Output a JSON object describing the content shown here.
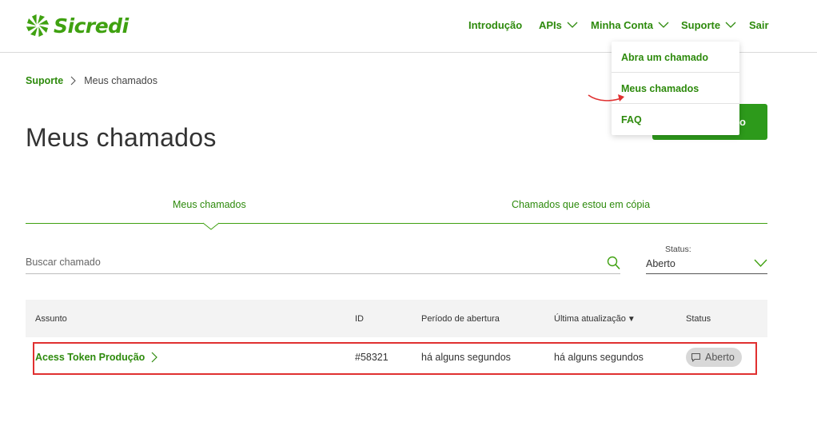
{
  "brand": {
    "name": "Sicredi",
    "color": "#3fa110"
  },
  "nav": {
    "items": [
      {
        "label": "Introdução",
        "has_dropdown": false
      },
      {
        "label": "APIs",
        "has_dropdown": true
      },
      {
        "label": "Minha Conta",
        "has_dropdown": true
      },
      {
        "label": "Suporte",
        "has_dropdown": true
      },
      {
        "label": "Sair",
        "has_dropdown": false
      }
    ]
  },
  "support_dropdown": {
    "items": [
      {
        "label": "Abra um chamado"
      },
      {
        "label": "Meus chamados"
      },
      {
        "label": "FAQ"
      }
    ]
  },
  "new_ticket_button": {
    "label": "o"
  },
  "breadcrumb": {
    "parent": "Suporte",
    "current": "Meus chamados"
  },
  "page": {
    "title": "Meus chamados"
  },
  "tabs": [
    {
      "label": "Meus chamados",
      "active": true
    },
    {
      "label": "Chamados que estou em cópia",
      "active": false
    }
  ],
  "search": {
    "placeholder": "Buscar chamado",
    "value": ""
  },
  "status_filter": {
    "label": "Status:",
    "selected": "Aberto"
  },
  "table": {
    "headers": {
      "subject": "Assunto",
      "id": "ID",
      "opened": "Período de abertura",
      "updated": "Última atualização",
      "updated_sort": "▼",
      "status": "Status"
    },
    "rows": [
      {
        "subject": "Acess Token Produção",
        "id": "#58321",
        "opened": "há alguns segundos",
        "updated": "há alguns segundos",
        "status": "Aberto"
      }
    ]
  },
  "colors": {
    "accent": "#2d8a0c",
    "button": "#2d9a1b",
    "annotation": "#e03030",
    "badge_bg": "#d8d8d8",
    "table_header_bg": "#f3f3f3"
  }
}
